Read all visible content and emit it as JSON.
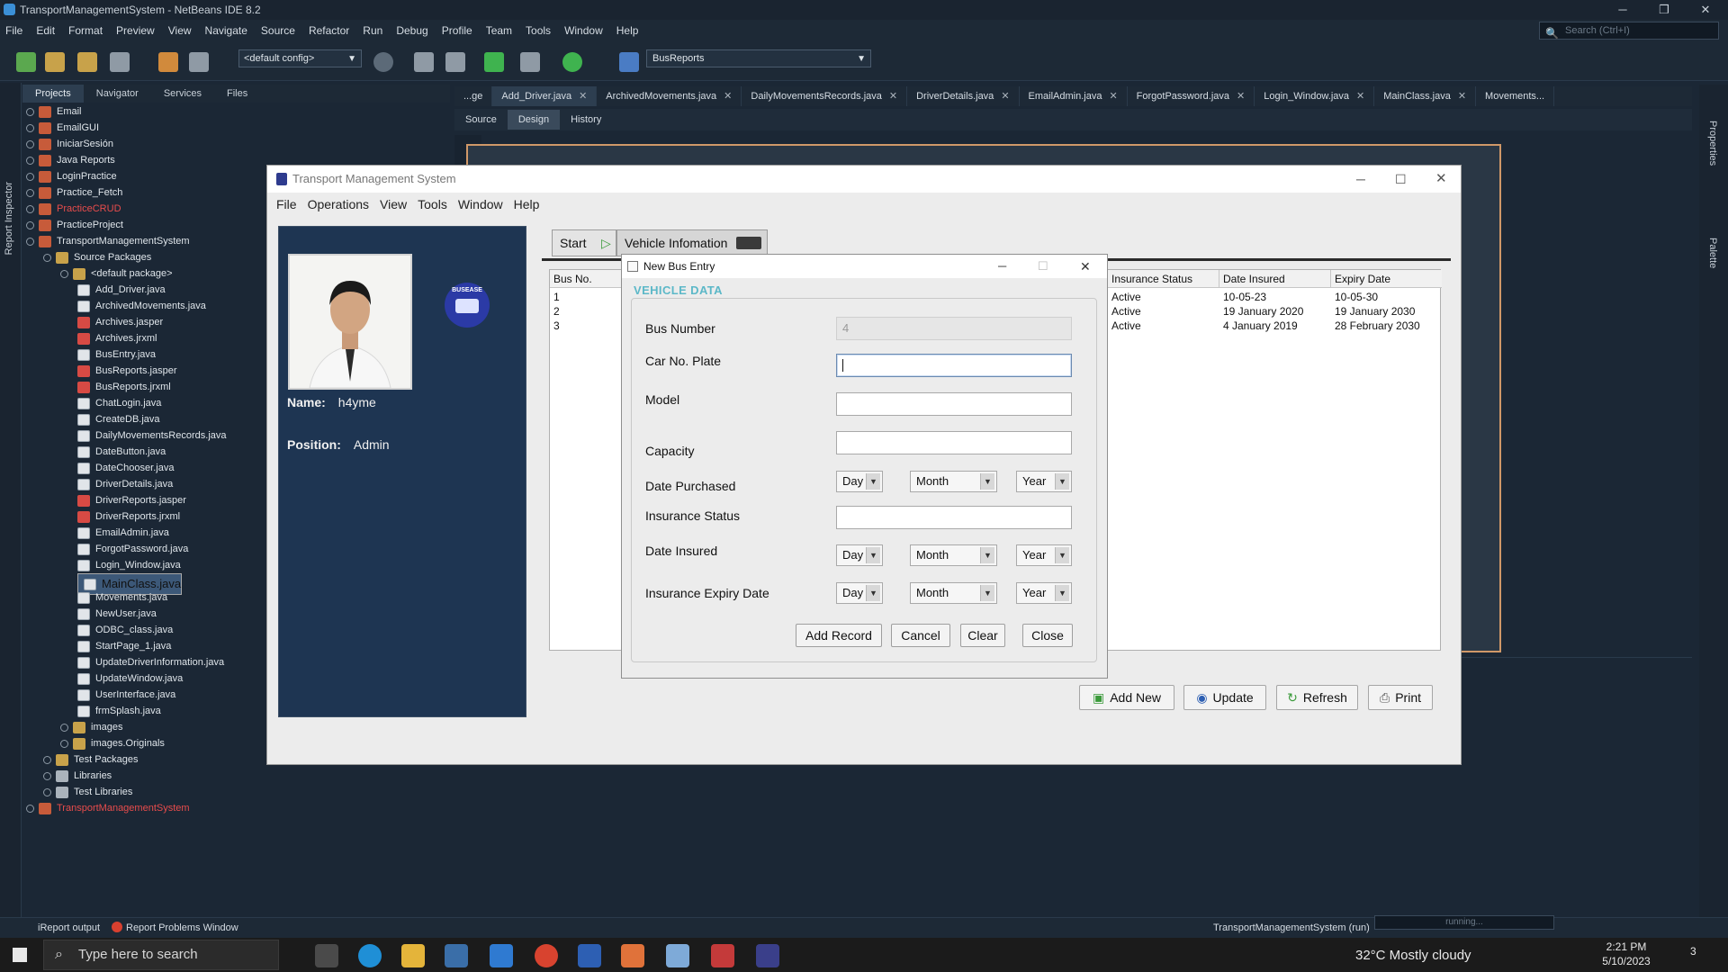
{
  "ide": {
    "title": "TransportManagementSystem - NetBeans IDE 8.2",
    "menu": [
      "File",
      "Edit",
      "Format",
      "Preview",
      "View",
      "Navigate",
      "Source",
      "Refactor",
      "Run",
      "Debug",
      "Profile",
      "Team",
      "Tools",
      "Window",
      "Help"
    ],
    "search_placeholder": "Search (Ctrl+I)",
    "config": "<default config>",
    "run_target": "BusReports",
    "left_strip_label": "Report Inspector",
    "panel_tabs": [
      "Projects",
      "Navigator",
      "Services",
      "Files"
    ],
    "tree": [
      {
        "label": "Email",
        "icon": "cup"
      },
      {
        "label": "EmailGUI",
        "icon": "cup"
      },
      {
        "label": "IniciarSesión",
        "icon": "cup"
      },
      {
        "label": "Java Reports",
        "icon": "cup"
      },
      {
        "label": "LoginPractice",
        "icon": "cup"
      },
      {
        "label": "Practice_Fetch",
        "icon": "cup"
      },
      {
        "label": "PracticeCRUD",
        "icon": "cup",
        "red": true
      },
      {
        "label": "PracticeProject",
        "icon": "cup"
      },
      {
        "label": "TransportManagementSystem",
        "icon": "cup"
      },
      {
        "label": "Source Packages",
        "icon": "pkg"
      },
      {
        "label": "<default package>",
        "icon": "pkg"
      },
      {
        "label": "Add_Driver.java",
        "icon": "java"
      },
      {
        "label": "ArchivedMovements.java",
        "icon": "java"
      },
      {
        "label": "Archives.jasper",
        "icon": "rep"
      },
      {
        "label": "Archives.jrxml",
        "icon": "rep"
      },
      {
        "label": "BusEntry.java",
        "icon": "java"
      },
      {
        "label": "BusReports.jasper",
        "icon": "rep"
      },
      {
        "label": "BusReports.jrxml",
        "icon": "rep"
      },
      {
        "label": "ChatLogin.java",
        "icon": "java"
      },
      {
        "label": "CreateDB.java",
        "icon": "java"
      },
      {
        "label": "DailyMovementsRecords.java",
        "icon": "java"
      },
      {
        "label": "DateButton.java",
        "icon": "java"
      },
      {
        "label": "DateChooser.java",
        "icon": "java"
      },
      {
        "label": "DriverDetails.java",
        "icon": "java"
      },
      {
        "label": "DriverReports.jasper",
        "icon": "rep"
      },
      {
        "label": "DriverReports.jrxml",
        "icon": "rep"
      },
      {
        "label": "EmailAdmin.java",
        "icon": "java"
      },
      {
        "label": "ForgotPassword.java",
        "icon": "java"
      },
      {
        "label": "Login_Window.java",
        "icon": "java"
      },
      {
        "label": "MainClass.java",
        "icon": "java",
        "selected": true
      },
      {
        "label": "Movements.java",
        "icon": "java"
      },
      {
        "label": "NewUser.java",
        "icon": "java"
      },
      {
        "label": "ODBC_class.java",
        "icon": "java"
      },
      {
        "label": "StartPage_1.java",
        "icon": "java"
      },
      {
        "label": "UpdateDriverInformation.java",
        "icon": "java"
      },
      {
        "label": "UpdateWindow.java",
        "icon": "java"
      },
      {
        "label": "UserInterface.java",
        "icon": "java"
      },
      {
        "label": "frmSplash.java",
        "icon": "java"
      },
      {
        "label": "images",
        "icon": "pkg"
      },
      {
        "label": "images.Originals",
        "icon": "pkg"
      },
      {
        "label": "Test Packages",
        "icon": "pkg"
      },
      {
        "label": "Libraries",
        "icon": "lib"
      },
      {
        "label": "Test Libraries",
        "icon": "lib"
      },
      {
        "label": "TransportManagementSystem",
        "icon": "cup",
        "red": true
      }
    ],
    "editor_tabs": [
      "...ge",
      "Add_Driver.java",
      "ArchivedMovements.java",
      "DailyMovementsRecords.java",
      "DriverDetails.java",
      "EmailAdmin.java",
      "ForgotPassword.java",
      "Login_Window.java",
      "MainClass.java",
      "Movements..."
    ],
    "editor_modes": [
      "Source",
      "Design",
      "History"
    ],
    "right_strip": [
      "Properties",
      "Palette"
    ],
    "status": {
      "ireport": "iReport output",
      "problems": "Report Problems Window",
      "run_task": "TransportManagementSystem (run)",
      "progress": "running..."
    }
  },
  "taskbar": {
    "search_placeholder": "Type here to search",
    "weather": "32°C  Mostly cloudy",
    "time": "2:21 PM",
    "date": "5/10/2023",
    "notifications": "3"
  },
  "app": {
    "title": "Transport Management System",
    "menu": [
      "File",
      "Operations",
      "View",
      "Tools",
      "Window",
      "Help"
    ],
    "profile": {
      "name_label": "Name:",
      "name": "h4yme",
      "position_label": "Position:",
      "position": "Admin"
    },
    "logo_text": "BUSEASE",
    "tabs": [
      "Start",
      "Vehicle Infomation"
    ],
    "table": {
      "columns": [
        "Bus No.",
        "Insurance Status",
        "Date Insured",
        "Expiry Date"
      ],
      "rows": [
        [
          "1",
          "Active",
          "10-05-23",
          "10-05-30"
        ],
        [
          "2",
          "Active",
          "19 January 2020",
          "19 January 2030"
        ],
        [
          "3",
          "Active",
          "4 January 2019",
          "28 February 2030"
        ]
      ]
    },
    "actions": [
      "Add New",
      "Update",
      "Refresh",
      "Print"
    ]
  },
  "dialog": {
    "title": "New Bus Entry",
    "section": "VEHICLE DATA",
    "labels": {
      "bus_number": "Bus Number",
      "plate": "Car No. Plate",
      "model": "Model",
      "capacity": "Capacity",
      "date_purchased": "Date Purchased",
      "insurance_status": "Insurance Status",
      "date_insured": "Date Insured",
      "expiry": "Insurance Expiry Date"
    },
    "bus_number_value": "4",
    "plate_value": "",
    "model_value": "",
    "capacity_value": "",
    "insurance_status_value": "",
    "selects": {
      "day": "Day",
      "month": "Month",
      "year": "Year"
    },
    "buttons": [
      "Add Record",
      "Cancel",
      "Clear",
      "Close"
    ]
  }
}
